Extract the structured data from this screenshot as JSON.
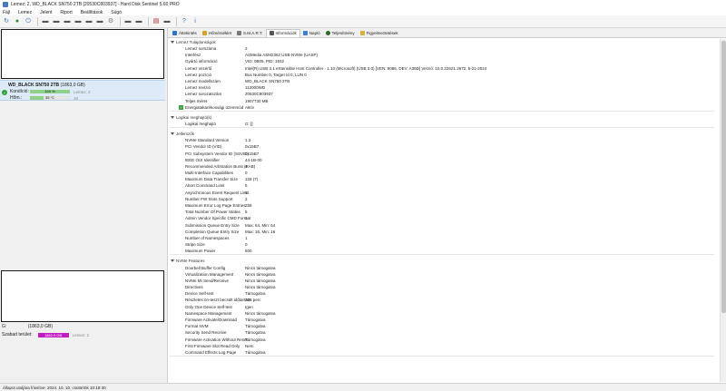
{
  "window": {
    "title": "Lemez: 2, WD_BLACK  SN750 2TB [20530C803937] - Hard Disk Sentinel 5.60 PRO"
  },
  "menu": [
    "Fájl",
    "Lemez",
    "Jelent",
    "Riport",
    "Beállítások",
    "Súgó"
  ],
  "toolbar_icons": [
    "refresh-icon",
    "globe-icon",
    "power-icon",
    "disk-icon",
    "disk-icon",
    "disk-icon",
    "disk-icon",
    "disk-icon",
    "disk-icon",
    "gear-icon",
    "disk-icon",
    "disk-icon",
    "chart-icon",
    "disk-icon",
    "help-icon",
    "info-icon"
  ],
  "colors": {
    "good": "#2fa33a",
    "temp": "#8fd18a",
    "free": "#c21cc2",
    "health": "#8fd18a"
  },
  "disk": {
    "name": "WD_BLACK  SN750 2TB",
    "size": "(1863,0 GB)",
    "condition_label": "Kondíció:",
    "condition_value": "100 %",
    "condition_extra": "Lemez: 2",
    "condition_pct": 100,
    "temp_label": "Hőm.:",
    "temp_value": "35 °C",
    "temp_extra": "10",
    "temp_pct": 35
  },
  "drive_footer": {
    "letter": "G:",
    "size": "(1863,0 GB)"
  },
  "free_space": {
    "label": "Szabad terület:",
    "value": "1862,9 GB",
    "extra": "Lemez: 2"
  },
  "tabs": [
    {
      "label": "Áttekintés",
      "color": "#2e75c9"
    },
    {
      "label": "Hőmérséklet",
      "color": "#d9a227"
    },
    {
      "label": "S.M.A.R.T.",
      "color": "#777777"
    },
    {
      "label": "Információk",
      "color": "#555555"
    },
    {
      "label": "Napló",
      "color": "#3a7fd6"
    },
    {
      "label": "Teljesítmény",
      "color": "#2a6a2a"
    },
    {
      "label": "Figyelmeztetések",
      "color": "#d6b23a"
    }
  ],
  "active_tab": 3,
  "sections": [
    {
      "title": "Lemez Tulajdonságok",
      "rows": [
        {
          "k": "Lemez sorszáma",
          "v": "2"
        },
        {
          "k": "Interfész",
          "v": "ASMedia ASM2362 USB-NVMe (UASP)"
        },
        {
          "k": "Gyártó információ",
          "v": "VID: 0B05, PID: 1932"
        },
        {
          "k": "Lemez vezérlő",
          "v": "Intel(R) USB 3.1 eXtensible Host Controller - 1.10 (Microsoft) (USB 3.0) [VEN: 8086, DEV: A36D] Verzió: 10.0.22621.2672, 5-21-2024"
        },
        {
          "k": "Lemez pozíció",
          "v": "Bus Number 0, Target Id 0, LUN 0"
        },
        {
          "k": "Lemez modellszám",
          "v": "WD_BLACK SN750 2TB"
        },
        {
          "k": "Lemez revízió",
          "v": "112000WD"
        },
        {
          "k": "Lemez sorozatszám",
          "v": "20530C803937"
        },
        {
          "k": "Teljes méret",
          "v": "1907730 MB"
        },
        {
          "k": "Energiatakarékossági üzemmód",
          "v": "Aktív",
          "icon": true
        }
      ]
    },
    {
      "title": "Logikai meghajtó(k)",
      "rows": [
        {
          "k": "Logikai meghajtó",
          "v": "G: []"
        }
      ]
    },
    {
      "title": "Jellemzők",
      "rows": [
        {
          "k": "NVMe Standard Version",
          "v": "1.3"
        },
        {
          "k": "PCI Vendor ID (VID)",
          "v": "0x15B7"
        },
        {
          "k": "PCI Subsystem Vendor ID (SSVID)",
          "v": "0x15B7"
        },
        {
          "k": "IEEE OUI Identifier",
          "v": "44-1B-00"
        },
        {
          "k": "Recommended Arbitration Burst (RAB)",
          "v": "4"
        },
        {
          "k": "Multi-Interface Capabilities",
          "v": "0"
        },
        {
          "k": "Maximum Data Transfer Size",
          "v": "128 (7)"
        },
        {
          "k": "Abort Command Limit",
          "v": "5"
        },
        {
          "k": "Asynchronous Event Request Limit",
          "v": "8"
        },
        {
          "k": "Number FW Slots Support",
          "v": "2"
        },
        {
          "k": "Maximum Error Log Page Entries",
          "v": "256"
        },
        {
          "k": "Total Number Of Power States",
          "v": "5"
        },
        {
          "k": "Admin Vendor Specific CMD Format",
          "v": "1"
        },
        {
          "k": "Submission Queue Entry Size",
          "v": "Max: 64, Min: 64"
        },
        {
          "k": "Completion Queue Entry Size",
          "v": "Max: 16, Min: 16"
        },
        {
          "k": "Number of Namespaces",
          "v": "1"
        },
        {
          "k": "Stripe Size",
          "v": "0"
        },
        {
          "k": "Maximum Power",
          "v": "600"
        }
      ]
    },
    {
      "title": "NVMe Features",
      "rows": [
        {
          "k": "Doorbell Buffer Config",
          "v": "Nincs támogatva"
        },
        {
          "k": "Virtualization Management",
          "v": "Nincs támogatva"
        },
        {
          "k": "NVMe MI Send/Receive",
          "v": "Nincs támogatva"
        },
        {
          "k": "Directives",
          "v": "Nincs támogatva"
        },
        {
          "k": "Device Self-test",
          "v": "Támogatva"
        },
        {
          "k": "Részletes ön-teszt becsült időtartam",
          "v": "206 perc"
        },
        {
          "k": "Only One Device Self-test",
          "v": "Igen"
        },
        {
          "k": "Namespace Management",
          "v": "Nincs támogatva"
        },
        {
          "k": "Firmware Activate/Download",
          "v": "Támogatva"
        },
        {
          "k": "Format NVM",
          "v": "Támogatva"
        },
        {
          "k": "Security Send Receive",
          "v": "Támogatva"
        },
        {
          "k": "Firmware Activation Without Reset",
          "v": "Támogatva"
        },
        {
          "k": "First Firmware Slot Read Only",
          "v": "Nem"
        },
        {
          "k": "Command Effects Log Page",
          "v": "Támogatva"
        }
      ]
    }
  ],
  "statusbar": {
    "text": "Állapot utoljára frissítve: 2024. 10. 10. csütörtök 10:18:30"
  }
}
